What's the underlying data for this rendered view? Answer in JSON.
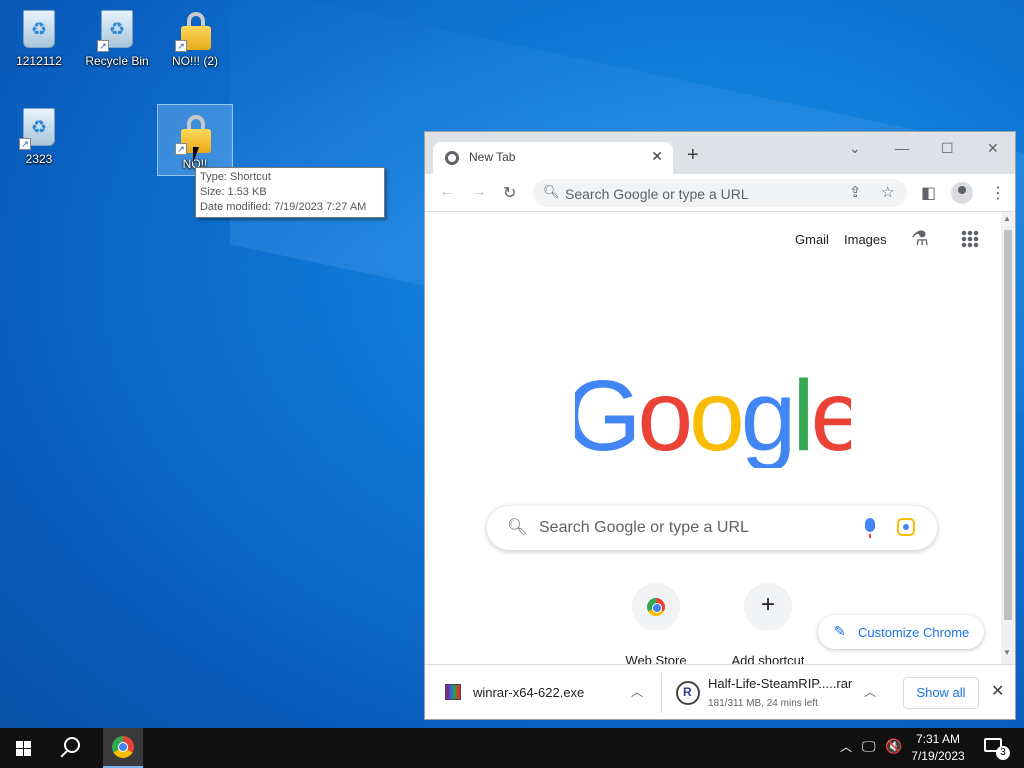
{
  "desktop": {
    "icons": [
      {
        "label": "1212112",
        "type": "recycle-bin"
      },
      {
        "label": "Recycle Bin",
        "type": "recycle-bin"
      },
      {
        "label": "NO!!! (2)",
        "type": "lock"
      },
      {
        "label": "2323",
        "type": "recycle-bin"
      },
      {
        "label": "NO!!",
        "type": "lock"
      }
    ],
    "tooltip": {
      "type": "Type: Shortcut",
      "size": "Size: 1.53 KB",
      "modified": "Date modified: 7/19/2023 7:27 AM"
    }
  },
  "browser": {
    "tab_title": "New Tab",
    "new_tab_symbol": "+",
    "omnibox_placeholder": "Search Google or type a URL",
    "top_links": {
      "gmail": "Gmail",
      "images": "Images"
    },
    "logo_letters": [
      {
        "ch": "G",
        "color": "#4285f4"
      },
      {
        "ch": "o",
        "color": "#ea4335"
      },
      {
        "ch": "o",
        "color": "#fbbc04"
      },
      {
        "ch": "g",
        "color": "#4285f4"
      },
      {
        "ch": "l",
        "color": "#34a853"
      },
      {
        "ch": "e",
        "color": "#ea4335"
      }
    ],
    "search_placeholder": "Search Google or type a URL",
    "shortcuts": [
      {
        "label": "Web Store"
      },
      {
        "label": "Add shortcut"
      }
    ],
    "customize_label": "Customize Chrome",
    "downloads": [
      {
        "name": "winrar-x64-622.exe"
      },
      {
        "name": "Half-Life-SteamRIP.....rar",
        "status": "181/311 MB, 24 mins left"
      }
    ],
    "show_all": "Show all"
  },
  "taskbar": {
    "time": "7:31 AM",
    "date": "7/19/2023",
    "notification_count": "3"
  },
  "colors": {
    "accent": "#1a73e8",
    "desktop_blue": "#0f78d7",
    "taskbar": "#101010"
  }
}
